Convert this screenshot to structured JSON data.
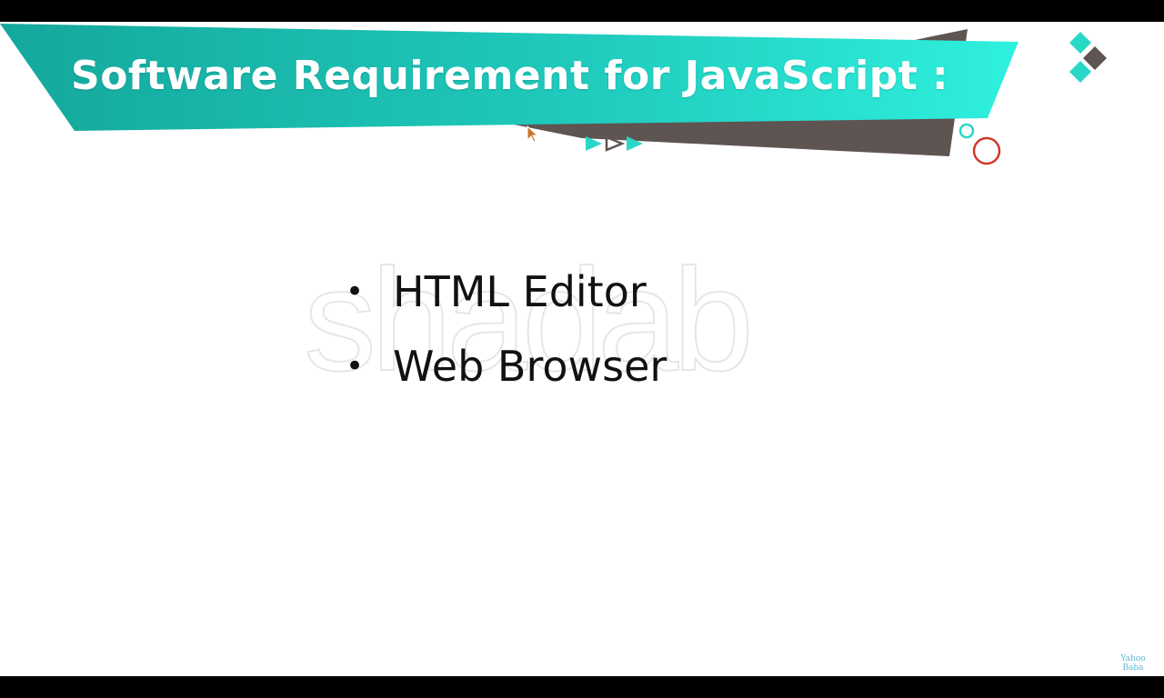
{
  "slide": {
    "title": "Software Requirement for JavaScript :",
    "bullets": [
      {
        "label": "HTML Editor"
      },
      {
        "label": "Web Browser"
      }
    ],
    "bullet_symbol": "•"
  },
  "watermark": {
    "text": "shadab"
  },
  "channel_logo": {
    "line1": "Yahoo",
    "line2": "Baba"
  },
  "colors": {
    "banner_start": "#14a89c",
    "banner_end": "#2ff0de",
    "shadow_band": "#5e5452",
    "accent_red": "#d13a2a",
    "teal": "#2ad8c8",
    "letterbox": "#000000",
    "body_text": "#111111"
  },
  "icons": [
    "play-triangle-icon",
    "play-triangle-outline-icon",
    "diamond-cluster-icon",
    "circle-outline-icon",
    "mouse-cursor-icon"
  ]
}
